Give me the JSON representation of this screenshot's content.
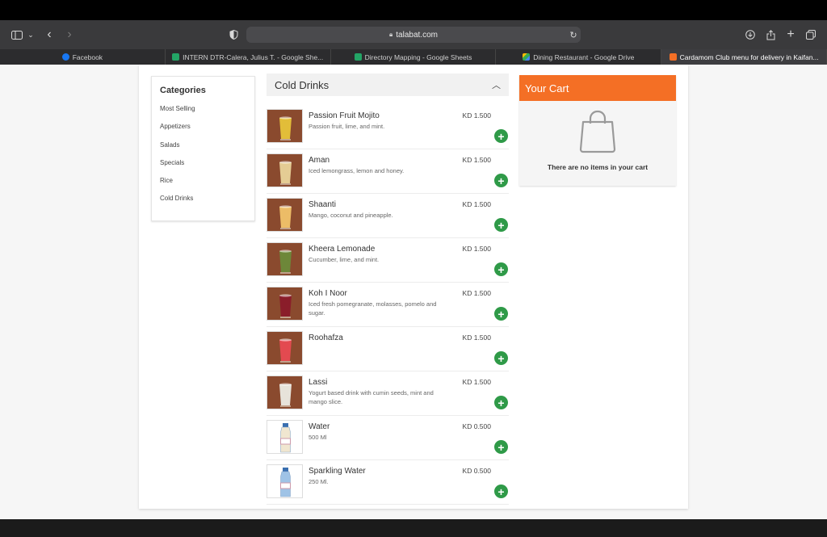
{
  "browser": {
    "url": "talabat.com",
    "tabs": [
      {
        "label": "Facebook",
        "icon": "facebook-icon",
        "color": "#1877f2",
        "active": false
      },
      {
        "label": "INTERN DTR-Calera, Julius T. - Google She...",
        "icon": "sheets-icon",
        "color": "#23a566",
        "active": false
      },
      {
        "label": "Directory Mapping - Google Sheets",
        "icon": "sheets-icon",
        "color": "#23a566",
        "active": false
      },
      {
        "label": "Dining Restaurant - Google Drive",
        "icon": "drive-icon",
        "color": "#fbbc04",
        "active": false
      },
      {
        "label": "Cardamom Club menu for delivery in Kaifan...",
        "icon": "talabat-icon",
        "color": "#f46f25",
        "active": true
      }
    ]
  },
  "categories": {
    "title": "Categories",
    "items": [
      "Most Selling",
      "Appetizers",
      "Salads",
      "Specials",
      "Rice",
      "Cold Drinks"
    ]
  },
  "menu": {
    "section_title": "Cold Drinks",
    "items": [
      {
        "name": "Passion Fruit Mojito",
        "desc": "Passion fruit, lime, and mint.",
        "price": "KD 1.500",
        "drink_color": "#e7c33a"
      },
      {
        "name": "Aman",
        "desc": "Iced lemongrass, lemon and honey.",
        "price": "KD 1.500",
        "drink_color": "#e9d39a"
      },
      {
        "name": "Shaanti",
        "desc": "Mango, coconut and pineapple.",
        "price": "KD 1.500",
        "drink_color": "#f1c26a"
      },
      {
        "name": "Kheera Lemonade",
        "desc": "Cucumber, lime, and mint.",
        "price": "KD 1.500",
        "drink_color": "#6b8a3a"
      },
      {
        "name": "Koh I Noor",
        "desc": "Iced fresh pomegranate, molasses, pomelo and sugar.",
        "price": "KD 1.500",
        "drink_color": "#8a1a2a"
      },
      {
        "name": "Roohafza",
        "desc": "",
        "price": "KD 1.500",
        "drink_color": "#e84a52"
      },
      {
        "name": "Lassi",
        "desc": "Yogurt based drink with cumin seeds, mint and mango slice.",
        "price": "KD 1.500",
        "drink_color": "#ecebe4"
      },
      {
        "name": "Water",
        "desc": "500 Ml",
        "price": "KD 0.500",
        "drink_color": "#f0e6d0"
      },
      {
        "name": "Sparkling Water",
        "desc": "250 Ml.",
        "price": "KD 0.500",
        "drink_color": "#9fc3e6"
      }
    ],
    "add_symbol": "+"
  },
  "cart": {
    "title": "Your Cart",
    "empty_text": "There are no items in your cart"
  }
}
